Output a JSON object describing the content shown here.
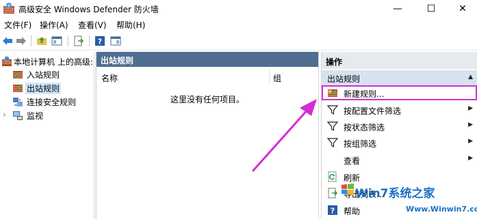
{
  "window": {
    "title": "高级安全 Windows Defender 防火墙",
    "minimize_glyph": "—",
    "maximize_glyph": "☐",
    "close_glyph": "✕"
  },
  "menu": [
    "文件(F)",
    "操作(A)",
    "查看(V)",
    "帮助(H)"
  ],
  "tree": {
    "root_label": "本地计算机 上的高级:",
    "items": [
      {
        "label": "入站规则",
        "icon": "inbound-rules-icon"
      },
      {
        "label": "出站规则",
        "icon": "outbound-rules-icon",
        "selected": true
      },
      {
        "label": "连接安全规则",
        "icon": "connection-security-icon"
      },
      {
        "label": "监视",
        "icon": "monitor-icon"
      }
    ],
    "expander_glyph": "›"
  },
  "center": {
    "header": "出站规则",
    "columns": [
      "名称",
      "组"
    ],
    "empty_message": "这里没有任何项目。"
  },
  "actions": {
    "title": "操作",
    "group_label": "出站规则",
    "group_caret": "▲",
    "items": [
      {
        "label": "新建规则...",
        "icon": "new-rule-icon",
        "has_submenu": false
      },
      {
        "label": "按配置文件筛选",
        "icon": "filter-icon",
        "has_submenu": true
      },
      {
        "label": "按状态筛选",
        "icon": "filter-icon",
        "has_submenu": true
      },
      {
        "label": "按组筛选",
        "icon": "filter-icon",
        "has_submenu": true
      },
      {
        "label": "查看",
        "icon": "",
        "has_submenu": true
      },
      {
        "label": "刷新",
        "icon": "refresh-icon",
        "has_submenu": false
      },
      {
        "label": "导出列表...",
        "icon": "export-icon",
        "has_submenu": false
      },
      {
        "label": "帮助",
        "icon": "help-icon",
        "has_submenu": false
      }
    ],
    "submenu_glyph": "▶"
  },
  "watermark": {
    "brand": "Win7系统之家",
    "url": "Www.Winwin7.com"
  },
  "colors": {
    "pane_header": "#4f6e92",
    "highlight_box": "#d52bd8",
    "annotation_arrow": "#d52bd8",
    "watermark": "#1b6fc4"
  }
}
